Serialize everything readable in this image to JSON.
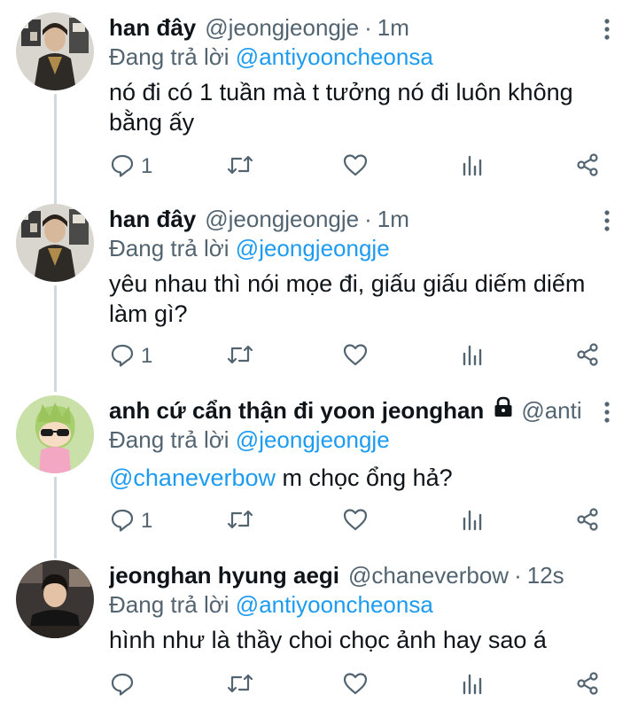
{
  "colors": {
    "accent": "#1d9bf0",
    "secondary_text": "#536471",
    "primary_text": "#0f1419",
    "thread_line": "#cfd9de"
  },
  "icons": [
    "reply-icon",
    "retweet-icon",
    "like-icon",
    "views-icon",
    "share-icon",
    "more-icon",
    "lock-icon"
  ],
  "tweets": [
    {
      "name": "han đây",
      "handle": "@jeongjeongje",
      "sep": "·",
      "time": "1m",
      "replying_prefix": "Đang trả lời",
      "replying_to": "@antiyooncheonsa",
      "text": "nó đi có 1 tuần mà t tưởng nó đi luôn không bằng ấy",
      "reply_count": "1"
    },
    {
      "name": "han đây",
      "handle": "@jeongjeongje",
      "sep": "·",
      "time": "1m",
      "replying_prefix": "Đang trả lời",
      "replying_to": "@jeongjeongje",
      "text": "yêu nhau thì nói mọe đi, giấu giấu diếm diếm làm gì?",
      "reply_count": "1"
    },
    {
      "name": "anh cứ cẩn thận đi yoon jeonghan",
      "handle": "@anti...",
      "replying_prefix": "Đang trả lời",
      "replying_to": "@jeongjeongje",
      "text_mention": "@chaneverbow",
      "text": " m chọc ổng hả?",
      "reply_count": "1"
    },
    {
      "name": "jeonghan hyung aegi",
      "handle": "@chaneverbow",
      "sep": "·",
      "time": "12s",
      "replying_prefix": "Đang trả lời",
      "replying_to": "@antiyooncheonsa",
      "text": "hình như là thầy choi chọc ảnh hay sao á",
      "reply_count": ""
    }
  ]
}
